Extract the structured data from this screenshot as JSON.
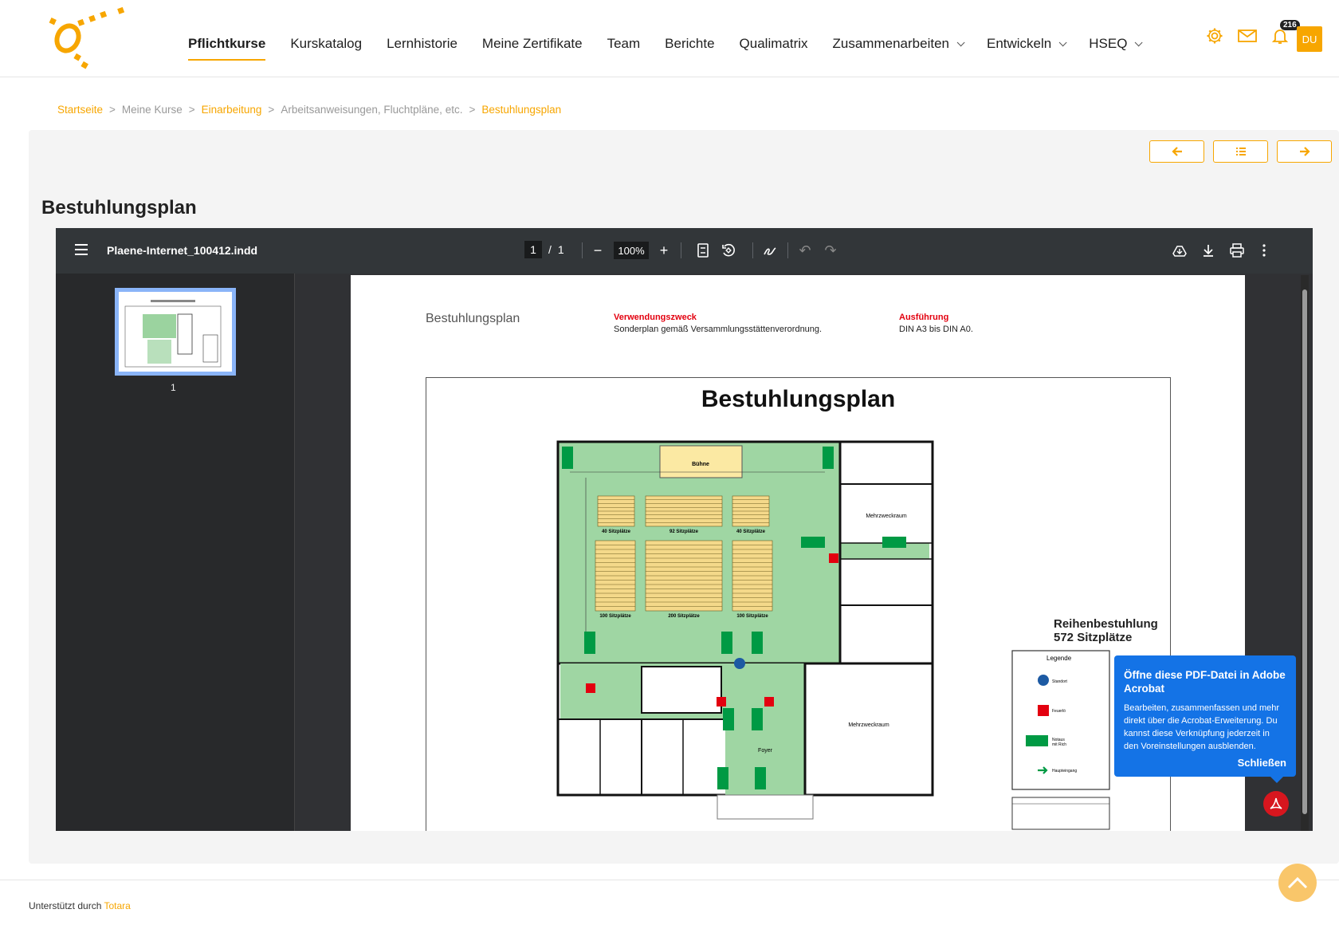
{
  "nav": {
    "items": [
      {
        "label": "Pflichtkurse",
        "active": true,
        "dropdown": false
      },
      {
        "label": "Kurskatalog",
        "active": false,
        "dropdown": false
      },
      {
        "label": "Lernhistorie",
        "active": false,
        "dropdown": false
      },
      {
        "label": "Meine Zertifikate",
        "active": false,
        "dropdown": false
      },
      {
        "label": "Team",
        "active": false,
        "dropdown": false
      },
      {
        "label": "Berichte",
        "active": false,
        "dropdown": false
      },
      {
        "label": "Qualimatrix",
        "active": false,
        "dropdown": false
      },
      {
        "label": "Zusammenarbeiten",
        "active": false,
        "dropdown": true
      },
      {
        "label": "Entwickeln",
        "active": false,
        "dropdown": true
      },
      {
        "label": "HSEQ",
        "active": false,
        "dropdown": true
      }
    ],
    "notification_count": "216",
    "avatar_initials": "DU",
    "accent": "#f7a600"
  },
  "breadcrumb": {
    "items": [
      "Startseite",
      "Meine Kurse",
      "Einarbeitung",
      "Arbeitsanweisungen, Fluchtpläne, etc.",
      "Bestuhlungsplan"
    ],
    "separator": ">"
  },
  "page": {
    "title": "Bestuhlungsplan"
  },
  "viewer": {
    "filename": "Plaene-Internet_100412.indd",
    "current_page": "1",
    "page_sep": "/",
    "total_pages": "1",
    "zoom": "100%",
    "thumb_label": "1"
  },
  "document": {
    "small_title": "Bestuhlungsplan",
    "purpose_label": "Verwendungszweck",
    "purpose_text": "Sonderplan gemäß Versammlungsstättenverordnung.",
    "exec_label": "Ausführung",
    "exec_text": "DIN A3 bis DIN A0.",
    "plan_title": "Bestuhlungsplan",
    "stage_label": "Bühne",
    "seat_blocks": [
      "40 Sitzplätze",
      "92 Sitzplätze",
      "40 Sitzplätze",
      "100 Sitzplätze",
      "200 Sitzplätze",
      "100 Sitzplätze"
    ],
    "room_labels": [
      "Mehrzweckraum",
      "Mehrzweckraum",
      "Foyer"
    ],
    "row_seating_title": "Reihenbestuhlung",
    "row_seating_count": "572 Sitzplätze",
    "legend_title": "Legende",
    "legend_items": [
      "Standort",
      "Feuerlö",
      "Notaus",
      "mit Rich",
      "Haupteingang"
    ]
  },
  "acrobat_popup": {
    "title": "Öffne diese PDF-Datei in Adobe Acrobat",
    "text": "Bearbeiten, zusammenfassen und mehr direkt über die Acrobat-Erweiterung. Du kannst diese Verknüpfung jederzeit in den Voreinstellungen ausblenden.",
    "close": "Schließen"
  },
  "footer": {
    "text": "Unterstützt durch",
    "link": "Totara"
  }
}
